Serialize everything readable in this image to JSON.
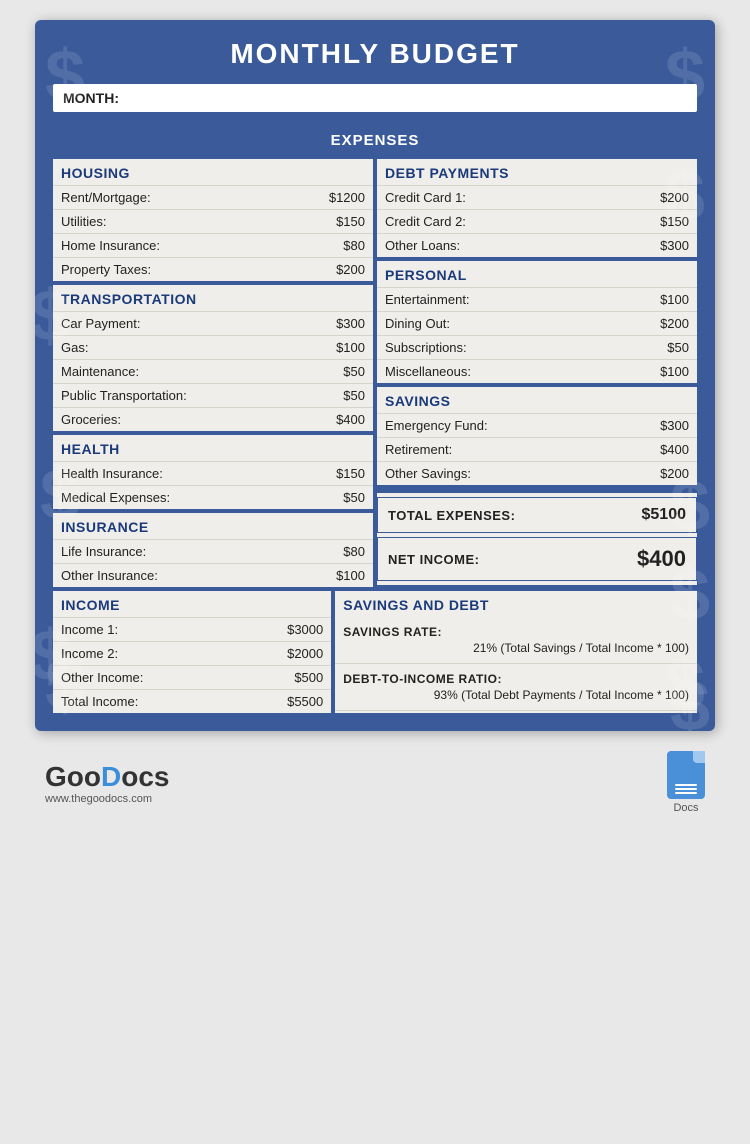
{
  "title": "MONTHLY BUDGET",
  "month_label": "MONTH:",
  "month_value": "",
  "expenses_header": "EXPENSES",
  "housing": {
    "title": "HOUSING",
    "items": [
      {
        "label": "Rent/Mortgage:",
        "value": "$1200"
      },
      {
        "label": "Utilities:",
        "value": "$150"
      },
      {
        "label": "Home Insurance:",
        "value": "$80"
      },
      {
        "label": "Property Taxes:",
        "value": "$200"
      }
    ]
  },
  "transportation": {
    "title": "TRANSPORTATION",
    "items": [
      {
        "label": "Car Payment:",
        "value": "$300"
      },
      {
        "label": "Gas:",
        "value": "$100"
      },
      {
        "label": "Maintenance:",
        "value": "$50"
      },
      {
        "label": "Public Transportation:",
        "value": "$50"
      },
      {
        "label": "Groceries:",
        "value": "$400"
      }
    ]
  },
  "health": {
    "title": "HEALTH",
    "items": [
      {
        "label": "Health Insurance:",
        "value": "$150"
      },
      {
        "label": "Medical Expenses:",
        "value": "$50"
      }
    ]
  },
  "insurance": {
    "title": "INSURANCE",
    "items": [
      {
        "label": "Life Insurance:",
        "value": "$80"
      },
      {
        "label": "Other Insurance:",
        "value": "$100"
      }
    ]
  },
  "debt_payments": {
    "title": "DEBT PAYMENTS",
    "items": [
      {
        "label": "Credit Card 1:",
        "value": "$200"
      },
      {
        "label": "Credit Card 2:",
        "value": "$150"
      },
      {
        "label": "Other Loans:",
        "value": "$300"
      }
    ]
  },
  "personal": {
    "title": "PERSONAL",
    "items": [
      {
        "label": "Entertainment:",
        "value": "$100"
      },
      {
        "label": "Dining Out:",
        "value": "$200"
      },
      {
        "label": "Subscriptions:",
        "value": "$50"
      },
      {
        "label": "Miscellaneous:",
        "value": "$100"
      }
    ]
  },
  "savings": {
    "title": "SAVINGS",
    "items": [
      {
        "label": "Emergency Fund:",
        "value": "$300"
      },
      {
        "label": "Retirement:",
        "value": "$400"
      },
      {
        "label": "Other Savings:",
        "value": "$200"
      }
    ]
  },
  "totals": {
    "total_expenses_label": "TOTAL EXPENSES:",
    "total_expenses_value": "$5100",
    "net_income_label": "NET INCOME:",
    "net_income_value": "$400"
  },
  "income": {
    "title": "INCOME",
    "items": [
      {
        "label": "Income 1:",
        "value": "$3000"
      },
      {
        "label": "Income 2:",
        "value": "$2000"
      },
      {
        "label": "Other Income:",
        "value": "$500"
      },
      {
        "label": "Total Income:",
        "value": "$5500"
      }
    ]
  },
  "savings_debt": {
    "title": "SAVINGS AND DEBT",
    "savings_rate_label": "SAVINGS RATE:",
    "savings_rate_value": "21% (Total Savings / Total Income * 100)",
    "debt_ratio_label": "DEBT-TO-INCOME RATIO:",
    "debt_ratio_value": "93% (Total Debt Payments / Total Income * 100)"
  },
  "footer": {
    "logo": "GooDocs",
    "url": "www.thegoodocs.com",
    "docs_label": "Docs"
  }
}
